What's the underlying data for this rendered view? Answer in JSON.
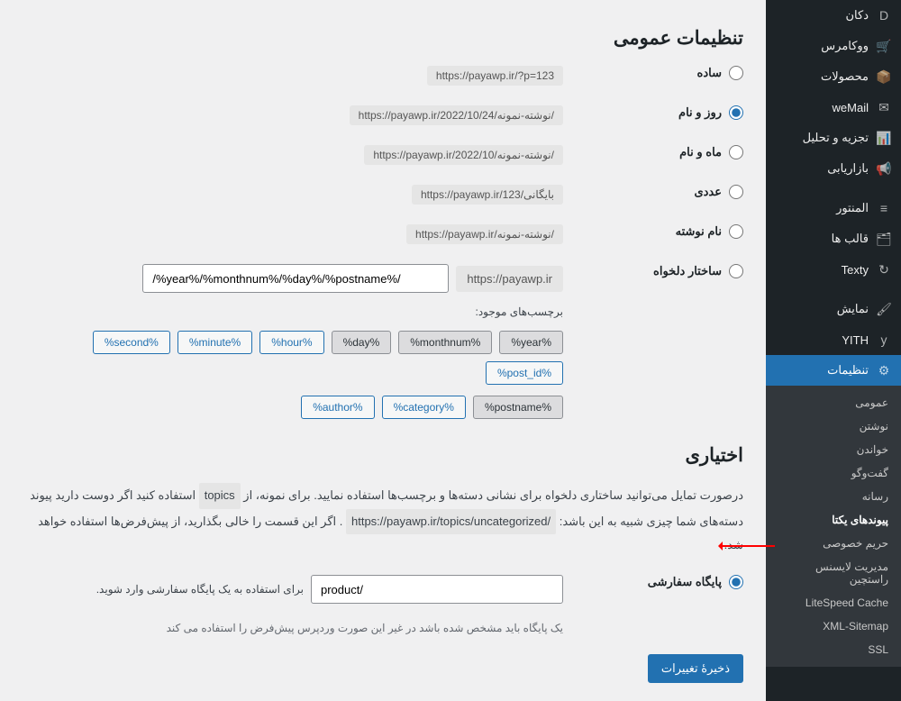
{
  "sidebar": {
    "top_items": [
      {
        "label": "دکان",
        "icon": "D"
      },
      {
        "label": "ووکامرس",
        "icon": "🛒"
      },
      {
        "label": "محصولات",
        "icon": "📦"
      },
      {
        "label": "weMail",
        "icon": "✉"
      },
      {
        "label": "تجزیه و تحلیل",
        "icon": "📊"
      },
      {
        "label": "بازاریابی",
        "icon": "📢"
      },
      {
        "label": "المنتور",
        "icon": "≡"
      },
      {
        "label": "قالب ها",
        "icon": "🗂"
      },
      {
        "label": "Texty",
        "icon": "↻"
      },
      {
        "label": "نمایش",
        "icon": "🖌"
      },
      {
        "label": "YITH",
        "icon": "y"
      }
    ],
    "settings_label": "تنظیمات",
    "settings_icon": "⚙",
    "submenu": [
      {
        "label": "عمومی"
      },
      {
        "label": "نوشتن"
      },
      {
        "label": "خواندن"
      },
      {
        "label": "گفت‌وگو"
      },
      {
        "label": "رسانه"
      },
      {
        "label": "پیوندهای یکتا",
        "active": true
      },
      {
        "label": "حریم خصوصی"
      },
      {
        "label": "مدیریت لایسنس راستچین"
      },
      {
        "label": "LiteSpeed Cache"
      },
      {
        "label": "XML-Sitemap"
      },
      {
        "label": "SSL"
      }
    ]
  },
  "main": {
    "general_title": "تنظیمات عمومی",
    "options": [
      {
        "name": "simple",
        "label": "ساده",
        "url": "https://payawp.ir/?p=123",
        "checked": false
      },
      {
        "name": "dayname",
        "label": "روز و نام",
        "url": "https://payawp.ir/2022/10/24/نوشته-نمونه/",
        "checked": true
      },
      {
        "name": "monthname",
        "label": "ماه و نام",
        "url": "https://payawp.ir/2022/10/نوشته-نمونه/",
        "checked": false
      },
      {
        "name": "numeric",
        "label": "عددی",
        "url": "https://payawp.ir/بایگانی/123",
        "checked": false
      },
      {
        "name": "postname",
        "label": "نام نوشته",
        "url": "https://payawp.ir/نوشته-نمونه/",
        "checked": false
      }
    ],
    "custom_label": "ساختار دلخواه",
    "custom_prefix": "https://payawp.ir",
    "custom_value": "/%year%/%monthnum%/%day%/%postname%/",
    "tags_label": "برچسب‌های موجود:",
    "tags_row1": [
      {
        "t": "%year%",
        "a": true
      },
      {
        "t": "%monthnum%",
        "a": true
      },
      {
        "t": "%day%",
        "a": true
      },
      {
        "t": "%hour%",
        "a": false
      },
      {
        "t": "%minute%",
        "a": false
      },
      {
        "t": "%second%",
        "a": false
      },
      {
        "t": "%post_id%",
        "a": false
      }
    ],
    "tags_row2": [
      {
        "t": "%postname%",
        "a": true
      },
      {
        "t": "%category%",
        "a": false
      },
      {
        "t": "%author%",
        "a": false
      }
    ],
    "optional_title": "اختیاری",
    "optional_desc_p1": "درصورت تمایل می‌توانید ساختاری دلخواه برای نشانی دسته‌ها و برچسب‌ها استفاده نمایید. برای نمونه، از",
    "optional_desc_pill1": "topics",
    "optional_desc_p2": "استفاده کنید اگر دوست دارید پیوند دسته‌های شما چیزی شبیه به این باشد:",
    "optional_desc_pill2": "https://payawp.ir/topics/uncategorized/",
    "optional_desc_p3": ". اگر این قسمت را خالی بگذارید، از پیش‌فرض‌ها استفاده خواهد شد.",
    "base_label": "پایگاه سفارشی",
    "base_value": "product/",
    "base_hint": "برای استفاده به یک پایگاه سفارشی وارد شوید.",
    "base_desc": "یک پایگاه باید مشخص شده باشد در غیر این صورت وردپرس پیش‌فرض را استفاده می کند",
    "save_label": "ذخیرهٔ تغییرات"
  }
}
